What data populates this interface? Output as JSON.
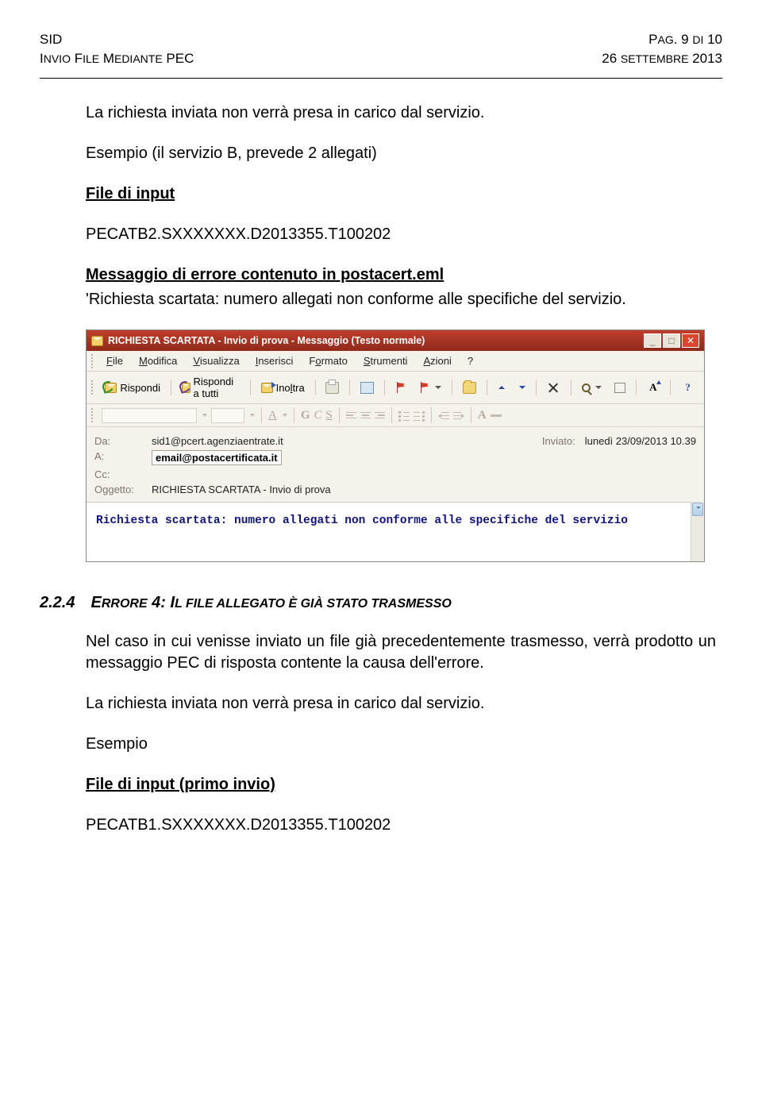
{
  "header": {
    "left1": "SID",
    "right1_pre": "P",
    "right1_sc": "AG",
    "right1_post": ". 9 ",
    "right1_di": "DI",
    "right1_end": " 10",
    "left2_pre": "I",
    "left2_sc1": "NVIO",
    "left2_mid1": " F",
    "left2_sc2": "ILE",
    "left2_mid2": " M",
    "left2_sc3": "EDIANTE",
    "left2_end": " PEC",
    "right2_pre": "26 ",
    "right2_sc": "SETTEMBRE",
    "right2_end": " 2013"
  },
  "body": {
    "p1": "La richiesta inviata non verrà presa in carico dal servizio.",
    "p2": "Esempio (il servizio B, prevede 2 allegati)",
    "file_input_label": "File di input",
    "file_input_value": "PECATB2.SXXXXXXX.D2013355.T100202",
    "msg_label": "Messaggio di errore contenuto in postacert.eml",
    "msg_quote": "'Richiesta scartata: numero allegati non conforme alle specifiche del servizio.",
    "sec_num": "2.2.4",
    "sec_title_pre": "E",
    "sec_title_sc1": "RRORE",
    "sec_title_mid1": " 4: I",
    "sec_title_sc2": "L FILE ALLEGATO È GIÀ STATO TRASMESSO",
    "sec_p1": "Nel caso in cui venisse inviato un file già precedentemente trasmesso, verrà prodotto un messaggio PEC di risposta contente la causa dell'errore.",
    "sec_p2": "La richiesta inviata non verrà presa in carico dal servizio.",
    "esempio": "Esempio",
    "file_input2_label": "File di input (primo invio)",
    "file_input2_value": "PECATB1.SXXXXXXX.D2013355.T100202"
  },
  "outlook": {
    "title": "RICHIESTA SCARTATA - Invio di prova - Messaggio (Testo normale)",
    "menu": {
      "file": "File",
      "modifica": "Modifica",
      "visualizza": "Visualizza",
      "inserisci": "Inserisci",
      "formato": "Formato",
      "strumenti": "Strumenti",
      "azioni": "Azioni",
      "help": "?"
    },
    "toolbar": {
      "rispondi": "Rispondi",
      "rispondi_tutti": "Rispondi a tutti",
      "inoltra": "Inoltra"
    },
    "format": {
      "A": "A",
      "G": "G",
      "C": "C",
      "S": "S",
      "Ahat": "A"
    },
    "labels": {
      "da": "Da:",
      "inviato": "Inviato:",
      "a": "A:",
      "cc": "Cc:",
      "oggetto": "Oggetto:"
    },
    "values": {
      "da": "sid1@pcert.agenziaentrate.it",
      "inviato": "lunedì 23/09/2013 10.39",
      "a": "email@postacertificata.it",
      "oggetto": "RICHIESTA SCARTATA - Invio di prova"
    },
    "body_line": "Richiesta scartata: numero allegati non conforme alle specifiche del servizio"
  }
}
